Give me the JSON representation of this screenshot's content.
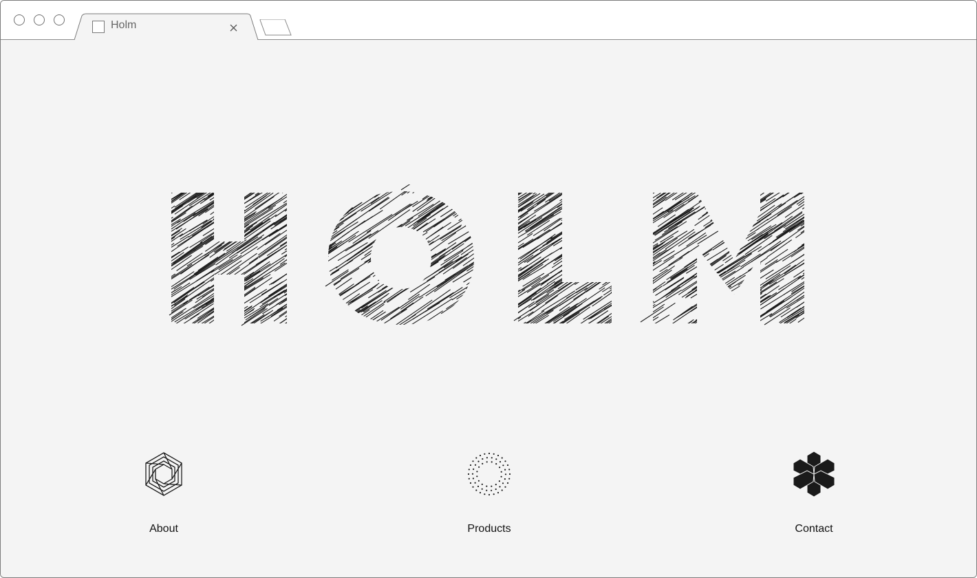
{
  "browser": {
    "tab_title": "Holm"
  },
  "hero": {
    "wordmark": "HOLM"
  },
  "nav": {
    "items": [
      {
        "label": "About",
        "icon": "hexagon-ring-icon"
      },
      {
        "label": "Products",
        "icon": "dotted-circle-icon"
      },
      {
        "label": "Contact",
        "icon": "asterisk-cube-icon"
      }
    ]
  },
  "colors": {
    "background": "#f4f4f4",
    "ink": "#1a1a1a"
  }
}
